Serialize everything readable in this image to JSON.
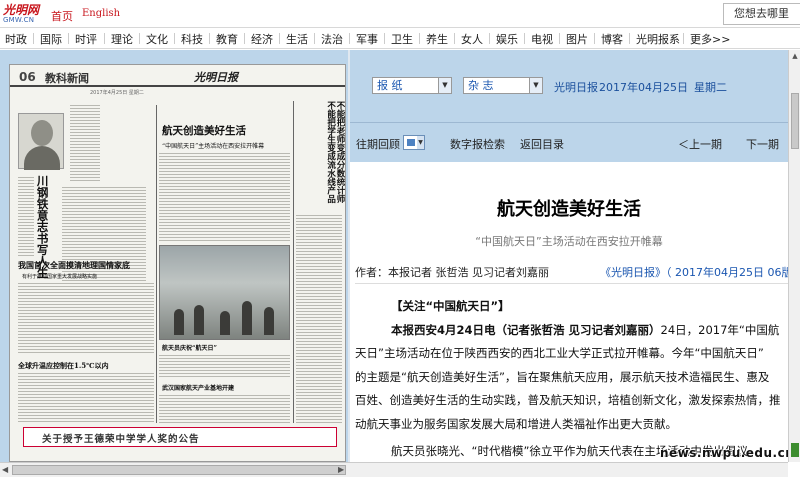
{
  "topbar": {
    "logo_brand": "光明网",
    "logo_sub": "GMW.CN",
    "home": "首页",
    "english": "English",
    "search_text": "您想去哪里"
  },
  "nav": [
    "时政",
    "国际",
    "时评",
    "理论",
    "文化",
    "科技",
    "教育",
    "经济",
    "生活",
    "法治",
    "军事",
    "卫生",
    "养生",
    "女人",
    "娱乐",
    "电视",
    "图片",
    "博客",
    "光明报系",
    "更多>>"
  ],
  "paper": {
    "page_no": "06",
    "page_name": "教科新闻",
    "masthead": "光明日报",
    "small_date": "2017年4月25日 星期二",
    "headline_main": "航天创造美好生活",
    "headline_sub": "“中国航天日”主场活动在西安拉开帷幕",
    "headline_right": "不能把老师变成分数统计师 不能把学生变成流水线产品",
    "vertical_head": "川钢铁意志书写人生",
    "headline_lower": "我国首次全面摸清地理国情家底",
    "headline_lower_sub": "有利于推动国家重大发展战略实施",
    "photo_caption": "航天员庆祝“航天日”",
    "headline_bottom": "全球升温应控制在1.5℃以内",
    "headline_bottom2": "武汉国家航天产业基地开建",
    "banner": "关于授予王德荣中学学人奖的公告"
  },
  "toolbar": {
    "select1": "报 纸",
    "select2": "杂 志",
    "paper_name": "光明日报",
    "date": "2017年04月25日",
    "weekday": "星期二"
  },
  "nav2": {
    "past": "往期回顾",
    "search": "数字报检索",
    "back": "返回目录",
    "prev": "＜上一期",
    "next": "下一期"
  },
  "article": {
    "title": "航天创造美好生活",
    "subtitle": "“中国航天日”主场活动在西安拉开帷幕",
    "byline": "作者：本报记者 张哲浩 见习记者刘嘉丽",
    "source": "《光明日报》（ 2017年04月25日 06版",
    "topic": "【关注“中国航天日”】",
    "lines": [
      "本报西安4月24日电（记者张哲浩 见习记者刘嘉丽）24日，2017年“中国航",
      "天日”主场活动在位于陕西西安的西北工业大学正式拉开帷幕。今年“中国航天日”",
      "的主题是“航天创造美好生活”，旨在聚焦航天应用，展示航天技术造福民生、惠及",
      "百姓、创造美好生活的生动实践，普及航天知识，培植创新文化，激发探索热情，推",
      "动航天事业为服务国家发展大局和增进人类福祉作出更大贡献。",
      "航天员张晓光、“时代楷模”徐立平作为航天代表在主场活动中发出倡议。"
    ],
    "lead_bold": "本报西安4月24日电（记者张哲浩 见习记者刘嘉丽）"
  },
  "watermark": "news.nwpu.edu.cn"
}
